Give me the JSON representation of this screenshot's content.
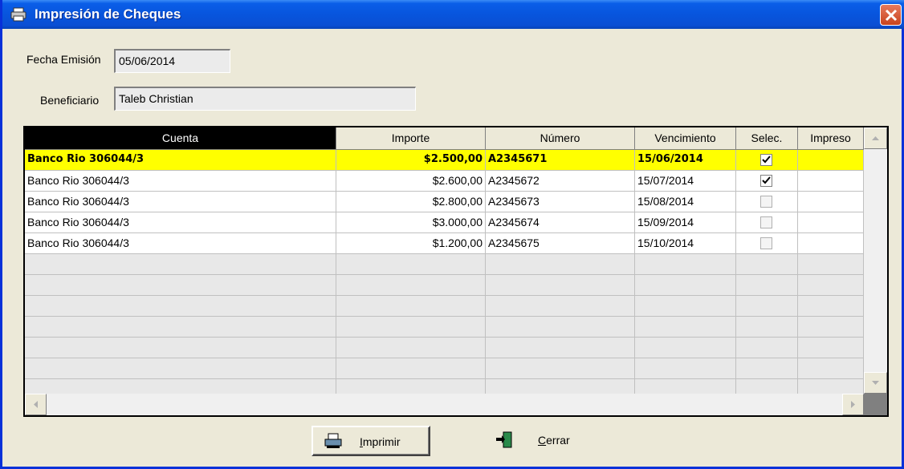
{
  "window": {
    "title": "Impresión de Cheques"
  },
  "form": {
    "fecha_label": "Fecha Emisión",
    "fecha_value": "05/06/2014",
    "beneficiario_label": "Beneficiario",
    "beneficiario_value": "Taleb Christian"
  },
  "table": {
    "columns": [
      "Cuenta",
      "Importe",
      "Número",
      "Vencimiento",
      "Selec.",
      "Impreso"
    ],
    "rows": [
      {
        "cuenta": "Banco Rio 306044/3",
        "importe": "$2.500,00",
        "numero": "A2345671",
        "vencimiento": "15/06/2014",
        "selec": true,
        "impreso": ""
      },
      {
        "cuenta": "Banco Rio 306044/3",
        "importe": "$2.600,00",
        "numero": "A2345672",
        "vencimiento": "15/07/2014",
        "selec": true,
        "impreso": ""
      },
      {
        "cuenta": "Banco Rio 306044/3",
        "importe": "$2.800,00",
        "numero": "A2345673",
        "vencimiento": "15/08/2014",
        "selec": false,
        "impreso": ""
      },
      {
        "cuenta": "Banco Rio 306044/3",
        "importe": "$3.000,00",
        "numero": "A2345674",
        "vencimiento": "15/09/2014",
        "selec": false,
        "impreso": ""
      },
      {
        "cuenta": "Banco Rio 306044/3",
        "importe": "$1.200,00",
        "numero": "A2345675",
        "vencimiento": "15/10/2014",
        "selec": false,
        "impreso": ""
      }
    ],
    "selected_row_color": "#ffff00"
  },
  "buttons": {
    "imprimir_first": "I",
    "imprimir_rest": "mprimir",
    "cerrar_first": "C",
    "cerrar_rest": "errar"
  },
  "icons": [
    "printer-icon",
    "close-icon",
    "exit-door-icon"
  ]
}
